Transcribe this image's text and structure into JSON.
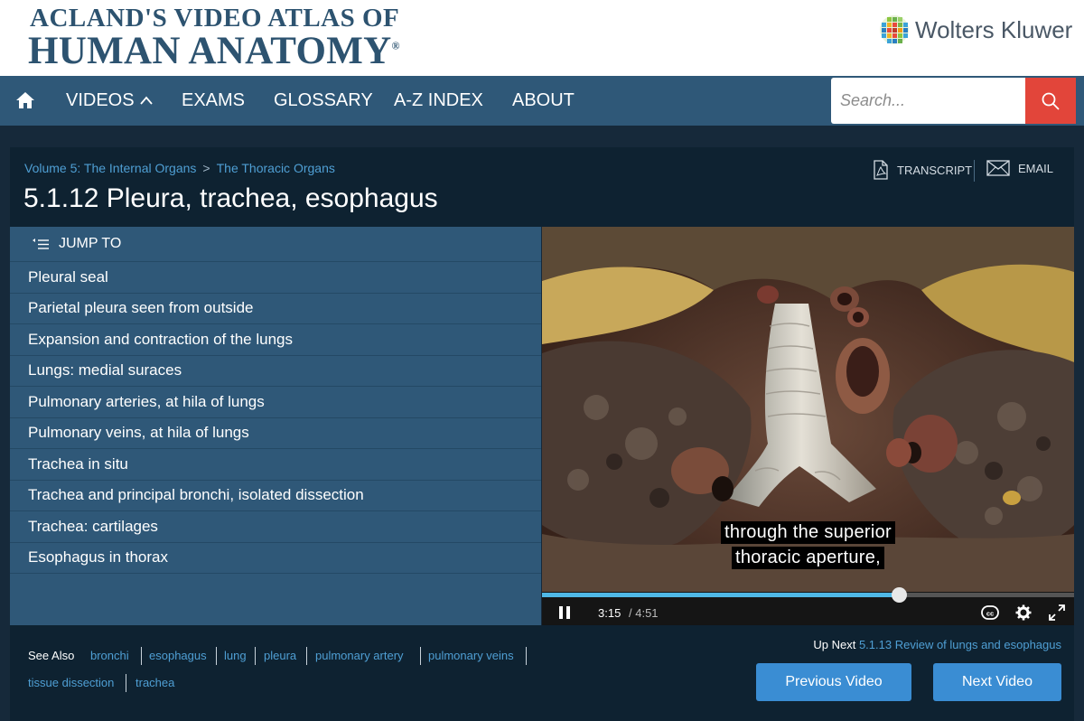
{
  "header": {
    "logo_line1": "ACLAND'S VIDEO ATLAS OF",
    "logo_line2": "HUMAN ANATOMY",
    "logo_reg": "®",
    "publisher": "Wolters Kluwer"
  },
  "nav": {
    "items": [
      "VIDEOS",
      "EXAMS",
      "GLOSSARY",
      "A-Z INDEX",
      "ABOUT"
    ],
    "icons": {
      "home": "home-icon",
      "videos_toggle": "chevron-up-icon",
      "search": "search-icon"
    },
    "search_placeholder": "Search..."
  },
  "breadcrumb": [
    "Volume 5: The Internal Organs",
    "The Thoracic Organs"
  ],
  "breadcrumb_separator": ">",
  "page_title": "5.1.12 Pleura, trachea, esophagus",
  "tools": {
    "transcript": "TRANSCRIPT",
    "email": "EMAIL"
  },
  "jump": {
    "heading": "JUMP TO",
    "items": [
      "Pleural seal",
      "Parietal pleura seen from outside",
      "Expansion and contraction of the lungs",
      "Lungs: medial suraces",
      "Pulmonary arteries, at hila of lungs",
      "Pulmonary veins, at hila of lungs",
      "Trachea in situ",
      "Trachea and principal bronchi, isolated dissection",
      "Trachea: cartilages",
      "Esophagus in thorax"
    ]
  },
  "video": {
    "subtitle_lines": [
      "through the superior",
      "thoracic aperture,"
    ],
    "current_time": "3:15",
    "duration": "/ 4:51",
    "progress": 0.67,
    "icons": {
      "play_pause": "pause-icon",
      "captions": "cc-icon",
      "settings": "gear-icon",
      "fullscreen": "fullscreen-icon"
    }
  },
  "footer": {
    "see_also_label": "See Also",
    "tags": [
      "bronchi",
      "esophagus",
      "lung",
      "pleura",
      "pulmonary artery",
      "pulmonary veins",
      "tissue dissection",
      "trachea"
    ],
    "up_next_label": "Up Next",
    "up_next_link": "5.1.13 Review of lungs and esophagus",
    "prev_button": "Previous Video",
    "next_button": "Next Video"
  },
  "colors": {
    "brand_navy": "#2d5370",
    "nav_bg": "#2f5878",
    "panel_bg": "#0e2231",
    "page_bg": "#16293a",
    "link": "#4f9fd4",
    "search_button": "#e2453a",
    "progress": "#4fb8e6",
    "button": "#3a8dd3"
  }
}
